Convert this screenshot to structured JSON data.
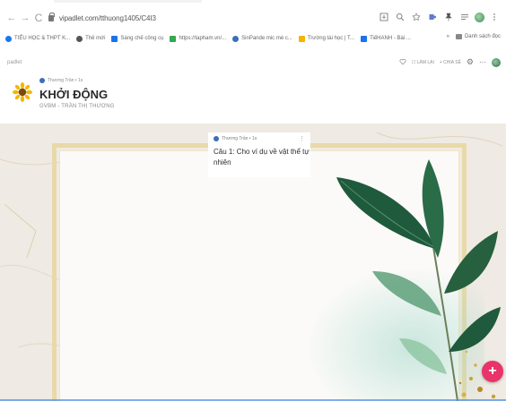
{
  "browser": {
    "nav": {
      "back": "←",
      "forward": "→",
      "reload": "C"
    },
    "url": "vipadlet.com/tthuong1405/C4I3",
    "toolbar_icons": [
      "download-icon",
      "zoom-icon",
      "star-icon",
      "extension-icon",
      "pin-icon",
      "menu-list-icon",
      "profile-icon",
      "kebab-icon"
    ]
  },
  "bookmarks": {
    "items": [
      {
        "label": "TIẾU HỌC & THPT K...",
        "color": "#1877f2",
        "icon": "facebook-icon"
      },
      {
        "label": "Thẻ mới",
        "color": "#555555",
        "icon": "globe-icon"
      },
      {
        "label": "Sáng chế công cụ",
        "color": "#1a73e8",
        "icon": "doc-icon"
      },
      {
        "label": "https://tapham.vn/...",
        "color": "#34a853",
        "icon": "link-icon"
      },
      {
        "label": "SinPande mic mè c...",
        "color": "#3b6fb6",
        "icon": "globe-icon"
      },
      {
        "label": "Trường tài học | T...",
        "color": "#f4b400",
        "icon": "school-icon"
      },
      {
        "label": "TiếHANH - Bài ...",
        "color": "#1a73e8",
        "icon": "doc-icon"
      }
    ],
    "overflow": "»",
    "reading_list": "Danh sách đọc"
  },
  "padlet": {
    "brand": "padlet",
    "actions": [
      "☐ LÀM LẠI",
      "+ CHIA SẺ"
    ],
    "author": "Thương Trần • 1s",
    "title": "KHỞI ĐỘNG",
    "subtitle": "GVBM - TRẦN THỊ THƯƠNG"
  },
  "post": {
    "author": "Thương Trần • 1s",
    "more": "⋮",
    "text": "Câu 1: Cho ví dụ về vật thể tự nhiên"
  },
  "fab": {
    "label": "+"
  },
  "colors": {
    "fab": "#e8336b",
    "title": "#2a2a2a",
    "frame": "#e8d9a8",
    "leaf_dark": "#1f5a3c",
    "leaf_light": "#5ea07a"
  }
}
